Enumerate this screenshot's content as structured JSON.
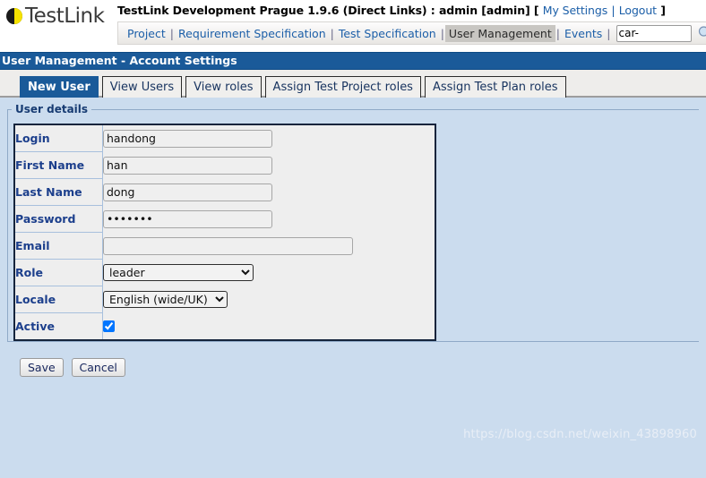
{
  "header": {
    "logo_text": "TestLink",
    "logo_icon": "testlink-pie-logo",
    "title_prefix": "TestLink Development Prague 1.9.6 (Direct Links) : admin [admin]",
    "bracket_open": "[",
    "bracket_close": "]",
    "my_settings_label": "My Settings",
    "logout_label": "Logout",
    "link_separator": "|"
  },
  "nav": {
    "separator": "|",
    "items": [
      {
        "label": "Project",
        "active": false
      },
      {
        "label": "Requirement Specification",
        "active": false
      },
      {
        "label": "Test Specification",
        "active": false
      },
      {
        "label": "User Management",
        "active": true
      },
      {
        "label": "Events",
        "active": false
      }
    ],
    "search": {
      "value": "car-",
      "placeholder": "",
      "icon": "search-icon"
    }
  },
  "page": {
    "title_bar": "User Management - Account Settings"
  },
  "tabs": [
    {
      "label": "New User",
      "active": true
    },
    {
      "label": "View Users",
      "active": false
    },
    {
      "label": "View roles",
      "active": false
    },
    {
      "label": "Assign Test Project roles",
      "active": false
    },
    {
      "label": "Assign Test Plan roles",
      "active": false
    }
  ],
  "form": {
    "legend": "User details",
    "rows": [
      {
        "label": "Login",
        "type": "text",
        "value": "handong"
      },
      {
        "label": "First Name",
        "type": "text",
        "value": "han"
      },
      {
        "label": "Last Name",
        "type": "text",
        "value": "dong"
      },
      {
        "label": "Password",
        "type": "password",
        "value": "1234567"
      },
      {
        "label": "Email",
        "type": "text",
        "value": ""
      },
      {
        "label": "Role",
        "type": "select",
        "value": "leader"
      },
      {
        "label": "Locale",
        "type": "select",
        "value": "English (wide/UK)"
      },
      {
        "label": "Active",
        "type": "checkbox",
        "value": "checked"
      }
    ],
    "role_options": [
      "leader"
    ],
    "locale_options": [
      "English (wide/UK)"
    ],
    "save_label": "Save",
    "cancel_label": "Cancel"
  },
  "watermark": {
    "text": "https://blog.csdn.net/weixin_43898960"
  },
  "colors": {
    "page_background": "#cbdcee",
    "title_bar": "#1a5a99",
    "link_blue": "#1c5fa8",
    "label_blue": "#1c3f8c",
    "tab_strip": "#eeedeb",
    "logo_yellow": "#f5e200"
  }
}
